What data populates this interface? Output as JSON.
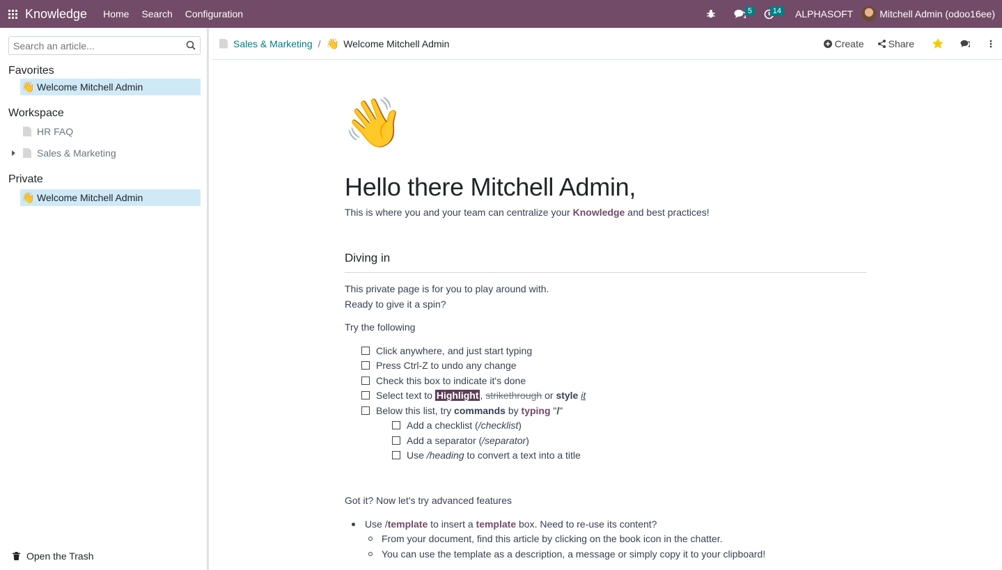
{
  "navbar": {
    "app_name": "Knowledge",
    "menu": [
      "Home",
      "Search",
      "Configuration"
    ],
    "messages_count": "5",
    "activities_count": "14",
    "company": "ALPHASOFT",
    "user": "Mitchell Admin (odoo16ee)",
    "brand_color": "#714B67",
    "badge_color": "#017e84"
  },
  "sidebar": {
    "search_placeholder": "Search an article...",
    "favorites_title": "Favorites",
    "favorites": [
      {
        "emoji": "👋",
        "label": "Welcome Mitchell Admin"
      }
    ],
    "workspace_title": "Workspace",
    "workspace": [
      {
        "label": "HR FAQ"
      },
      {
        "label": "Sales & Marketing"
      }
    ],
    "private_title": "Private",
    "private": [
      {
        "emoji": "👋",
        "label": "Welcome Mitchell Admin"
      }
    ],
    "trash_label": "Open the Trash"
  },
  "breadcrumb": {
    "parent": "Sales & Marketing",
    "current_emoji": "👋",
    "current": "Welcome Mitchell Admin"
  },
  "actions": {
    "create": "Create",
    "share": "Share"
  },
  "article": {
    "icon": "👋",
    "title": "Hello there Mitchell Admin,",
    "lead_before": "This is where you and your team can centralize your ",
    "lead_accent": "Knowledge",
    "lead_after": " and best practices!",
    "section_heading": "Diving in",
    "p1": "This private page is for you to play around with.",
    "p2": "Ready to give it a spin?",
    "p3": "Try the following",
    "checklist": {
      "item1": "Click anywhere, and just start typing",
      "item2": "Press Ctrl-Z to undo any change",
      "item3": "Check this box to indicate it's done",
      "item4": {
        "before": "Select text to ",
        "highlight": "Highlight",
        "comma": ", ",
        "strike": "strikethrough",
        "or": " or ",
        "style": "style",
        "space": " ",
        "it": "it"
      },
      "item5": {
        "before": "Below this list, try ",
        "commands": "commands",
        "by": " by ",
        "typing": "typing",
        "quote_open": " \"",
        "slash": "/",
        "quote_close": "\""
      },
      "sub1": {
        "before": "Add a checklist (",
        "cmd": "/checklist",
        "after": ")"
      },
      "sub2": {
        "before": "Add a separator (",
        "cmd": "/separator",
        "after": ")"
      },
      "sub3": {
        "before": "Use ",
        "cmd": "/heading",
        "after": " to convert a text into a title"
      }
    },
    "p4": "Got it? Now let's try advanced features",
    "bullet1": {
      "before": "Use /",
      "cmd": "template",
      "mid": " to insert a ",
      "word": "template",
      "after": " box. Need to re-use its content?"
    },
    "sub_bullet1": "From your document, find this article by clicking on the book icon in the chatter.",
    "sub_bullet2": "You can use the template as a description, a message or simply copy it to your clipboard!"
  }
}
